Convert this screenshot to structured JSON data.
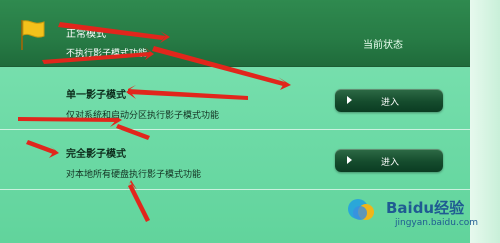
{
  "current_mode": {
    "title": "正常模式",
    "description": "不执行影子模式功能",
    "status_label": "当前状态"
  },
  "modes": [
    {
      "title": "单一影子模式",
      "description": "仅对系统和启动分区执行影子模式功能",
      "button_label": "进入"
    },
    {
      "title": "完全影子模式",
      "description": "对本地所有硬盘执行影子模式功能",
      "button_label": "进入"
    }
  ],
  "watermark": {
    "brand": "Baidu经验",
    "url": "jingyan.baidu.com"
  },
  "colors": {
    "header_green": "#277b45",
    "panel_mint": "#6ddaa6",
    "button_dark": "#154c2d",
    "annotation_red": "#e1261c",
    "flag_yellow": "#f4c21b"
  }
}
